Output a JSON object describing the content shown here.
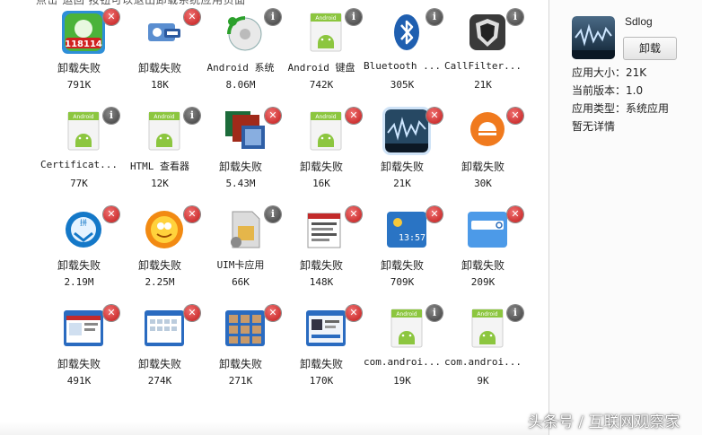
{
  "hint": "点击 运回 按钮可以退出卸载系统应用页面",
  "apps": [
    {
      "name": "卸载失败",
      "size": "791K",
      "badge": "x",
      "icon": "phone-icon"
    },
    {
      "name": "卸载失败",
      "size": "18K",
      "badge": "x",
      "icon": "contact-card-icon"
    },
    {
      "name": "Android 系统",
      "size": "8.06M",
      "badge": "i",
      "icon": "android-system-disc-icon"
    },
    {
      "name": "Android 键盘",
      "size": "742K",
      "badge": "i",
      "icon": "android-default-icon"
    },
    {
      "name": "Bluetooth ...",
      "size": "305K",
      "badge": "i",
      "icon": "bluetooth-icon"
    },
    {
      "name": "CallFilter...",
      "size": "21K",
      "badge": "i",
      "icon": "call-filter-shield-icon"
    },
    {
      "name": "Certificat...",
      "size": "77K",
      "badge": "i",
      "icon": "android-default-icon"
    },
    {
      "name": "HTML 查看器",
      "size": "12K",
      "badge": "i",
      "icon": "android-default-icon"
    },
    {
      "name": "卸载失败",
      "size": "5.43M",
      "badge": "x",
      "icon": "squares-app-icon"
    },
    {
      "name": "卸载失败",
      "size": "16K",
      "badge": "x",
      "icon": "android-default-icon"
    },
    {
      "name": "卸载失败",
      "size": "21K",
      "badge": "x",
      "icon": "chart-app-icon"
    },
    {
      "name": "卸载失败",
      "size": "30K",
      "badge": "x",
      "icon": "orange-bubble-icon"
    },
    {
      "name": "卸载失败",
      "size": "2.19M",
      "badge": "x",
      "icon": "pinyin-input-icon"
    },
    {
      "name": "卸载失败",
      "size": "2.25M",
      "badge": "x",
      "icon": "uc-browser-icon"
    },
    {
      "name": "UIM卡应用",
      "size": "66K",
      "badge": "i",
      "icon": "sim-card-icon"
    },
    {
      "name": "卸载失败",
      "size": "148K",
      "badge": "x",
      "icon": "doc-list-icon"
    },
    {
      "name": "卸载失败",
      "size": "709K",
      "badge": "x",
      "icon": "weather-clock-icon"
    },
    {
      "name": "卸载失败",
      "size": "209K",
      "badge": "x",
      "icon": "search-widget-icon"
    },
    {
      "name": "卸载失败",
      "size": "491K",
      "badge": "x",
      "icon": "web-window-icon"
    },
    {
      "name": "卸载失败",
      "size": "274K",
      "badge": "x",
      "icon": "calendar-window-icon"
    },
    {
      "name": "卸载失败",
      "size": "271K",
      "badge": "x",
      "icon": "gallery-icon"
    },
    {
      "name": "卸载失败",
      "size": "170K",
      "badge": "x",
      "icon": "music-player-icon"
    },
    {
      "name": "com.androi...",
      "size": "19K",
      "badge": "i",
      "icon": "android-default-icon"
    },
    {
      "name": "com.androi...",
      "size": "9K",
      "badge": "i",
      "icon": "android-default-icon"
    }
  ],
  "selected_index": 10,
  "panel": {
    "app_name": "Sdlog",
    "uninstall_label": "卸载",
    "size_line": "应用大小：21K",
    "version_line": "当前版本：1.0",
    "type_line": "应用类型：系统应用",
    "details_line": "暂无详情"
  },
  "watermark": "头条号 / 互联网观察家",
  "colors": {
    "delete_badge": "#d32222",
    "info_badge": "#444444",
    "selection": "#cfe3f7",
    "android_green": "#7fbf2a"
  }
}
